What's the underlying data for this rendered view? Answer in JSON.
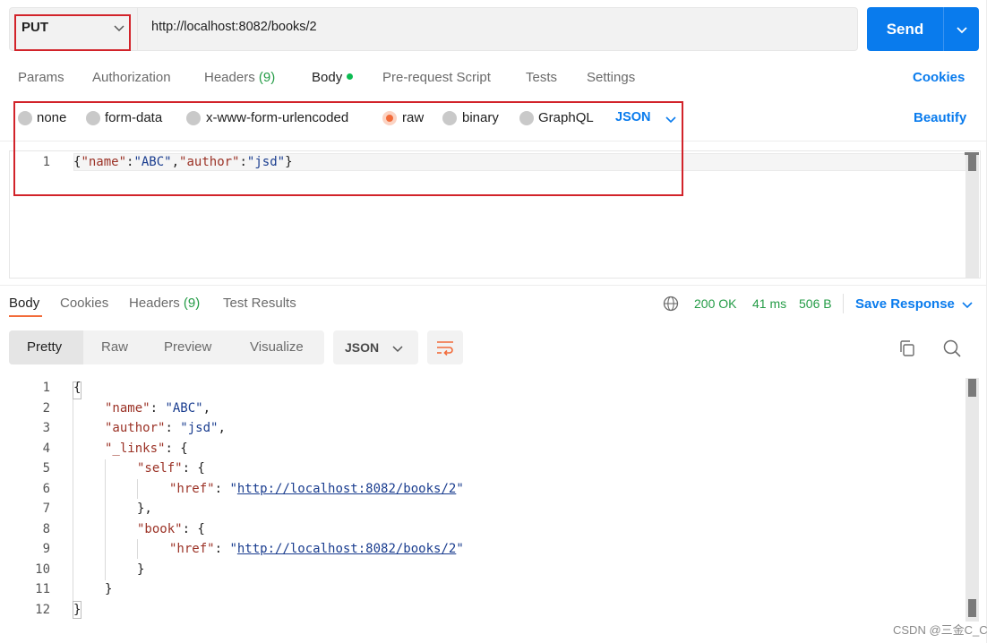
{
  "request": {
    "method": "PUT",
    "url": "http://localhost:8082/books/2",
    "send_label": "Send"
  },
  "request_tabs": {
    "params": "Params",
    "authorization": "Authorization",
    "headers": "Headers",
    "headers_count": "(9)",
    "body": "Body",
    "prerequest": "Pre-request Script",
    "tests": "Tests",
    "settings": "Settings",
    "cookies": "Cookies"
  },
  "body_types": {
    "none": "none",
    "form_data": "form-data",
    "urlencoded": "x-www-form-urlencoded",
    "raw": "raw",
    "binary": "binary",
    "graphql": "GraphQL",
    "language": "JSON",
    "beautify": "Beautify"
  },
  "request_body": {
    "line_number": "1",
    "open": "{",
    "key1": "\"name\"",
    "colon1": ":",
    "val1": "\"ABC\"",
    "comma1": ",",
    "key2": "\"author\"",
    "colon2": ":",
    "val2": "\"jsd\"",
    "close": "}"
  },
  "response_tabs": {
    "body": "Body",
    "cookies": "Cookies",
    "headers": "Headers",
    "headers_count": "(9)",
    "test_results": "Test Results",
    "status": "200 OK",
    "time": "41 ms",
    "size": "506 B",
    "save_response": "Save Response"
  },
  "view_modes": {
    "pretty": "Pretty",
    "raw": "Raw",
    "preview": "Preview",
    "visualize": "Visualize",
    "format": "JSON"
  },
  "response_body": {
    "line_numbers": [
      "1",
      "2",
      "3",
      "4",
      "5",
      "6",
      "7",
      "8",
      "9",
      "10",
      "11",
      "12"
    ],
    "l1": "{",
    "l2_key": "\"name\"",
    "l2_sep": ": ",
    "l2_val": "\"ABC\"",
    "l2_end": ",",
    "l3_key": "\"author\"",
    "l3_sep": ": ",
    "l3_val": "\"jsd\"",
    "l3_end": ",",
    "l4_key": "\"_links\"",
    "l4_sep": ": {",
    "l5_key": "\"self\"",
    "l5_sep": ": {",
    "l6_key": "\"href\"",
    "l6_sep": ": ",
    "l6_q1": "\"",
    "l6_url": "http://localhost:8082/books/2",
    "l6_q2": "\"",
    "l7": "},",
    "l8_key": "\"book\"",
    "l8_sep": ": {",
    "l9_key": "\"href\"",
    "l9_sep": ": ",
    "l9_q1": "\"",
    "l9_url": "http://localhost:8082/books/2",
    "l9_q2": "\"",
    "l10": "}",
    "l11": "}",
    "l12": "}"
  },
  "watermark": "CSDN @三金C_C",
  "colors": {
    "accent_blue": "#097bed",
    "accent_orange": "#f26b3a",
    "status_green": "#259c47",
    "highlight_red": "#d2232a"
  }
}
